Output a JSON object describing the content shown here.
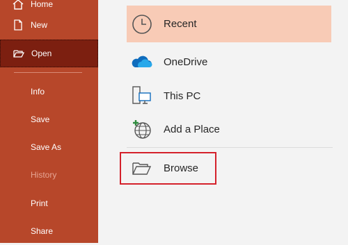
{
  "sidebar": {
    "items": [
      {
        "label": "Home",
        "icon": "home-icon",
        "state": "normal"
      },
      {
        "label": "New",
        "icon": "new-document-icon",
        "state": "normal"
      },
      {
        "label": "Open",
        "icon": "folder-open-icon",
        "state": "selected"
      },
      {
        "label": "Info",
        "state": "normal"
      },
      {
        "label": "Save",
        "state": "normal"
      },
      {
        "label": "Save As",
        "state": "normal"
      },
      {
        "label": "History",
        "state": "disabled"
      },
      {
        "label": "Print",
        "state": "normal"
      },
      {
        "label": "Share",
        "state": "normal"
      }
    ],
    "background": "#b7472a",
    "selected_background": "#7c1f10"
  },
  "locations": {
    "recent": {
      "label": "Recent",
      "icon": "clock-icon",
      "highlighted": true
    },
    "onedrive": {
      "label": "OneDrive",
      "icon": "cloud-icon"
    },
    "this_pc": {
      "label": "This PC",
      "icon": "computer-icon"
    },
    "add_place": {
      "label": "Add a Place",
      "icon": "globe-add-icon"
    },
    "browse": {
      "label": "Browse",
      "icon": "folder-icon",
      "outlined": true
    }
  },
  "colors": {
    "highlight": "#f8cbb6",
    "outline": "#d4202a"
  }
}
